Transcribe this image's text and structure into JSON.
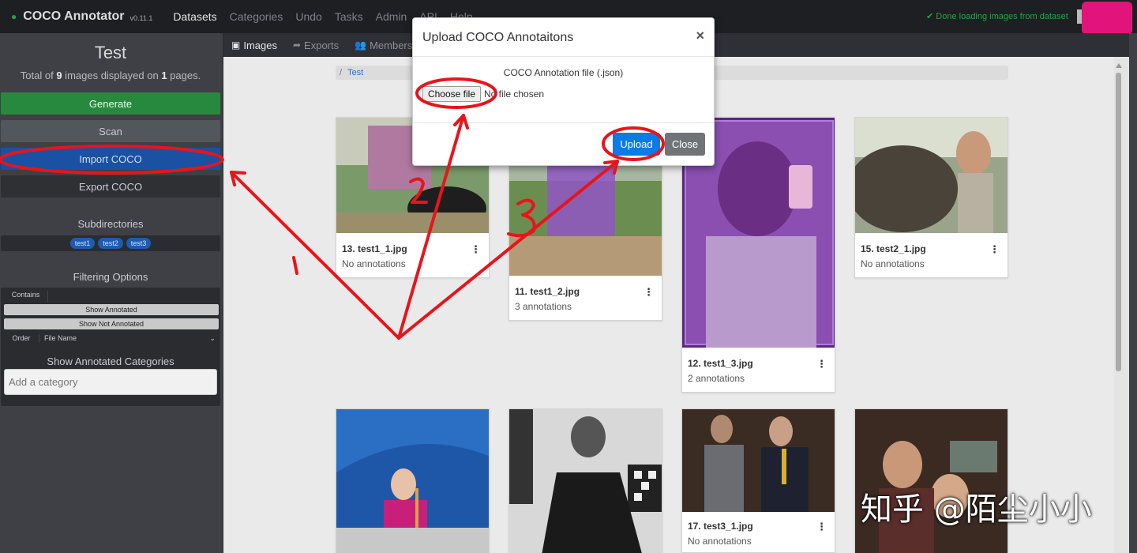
{
  "navbar": {
    "brand": "COCO Annotator",
    "version": "v0.11.1",
    "links": [
      "Datasets",
      "Categories",
      "Undo",
      "Tasks",
      "Admin",
      "API",
      "Help"
    ],
    "status": "Done loading images from dataset"
  },
  "sidebar": {
    "title": "Test",
    "info_prefix": "Total of ",
    "image_count": "9",
    "info_mid": " images displayed on ",
    "page_count": "1",
    "info_suffix": " pages.",
    "buttons": {
      "generate": "Generate",
      "scan": "Scan",
      "import": "Import COCO",
      "export": "Export COCO"
    },
    "subdirectories_label": "Subdirectories",
    "subdirectories": [
      "test1",
      "test2",
      "test3"
    ],
    "filtering_label": "Filtering Options",
    "contains_label": "Contains",
    "show_annotated": "Show Annotated",
    "show_not_annotated": "Show Not Annotated",
    "order_label": "Order",
    "order_value": "File Name",
    "categories_label": "Show Annotated Categories",
    "category_placeholder": "Add a category"
  },
  "subnav": {
    "tabs": [
      "Images",
      "Exports",
      "Members"
    ]
  },
  "breadcrumb": {
    "sep": "/",
    "current": "Test"
  },
  "cards": [
    {
      "name": "13. test1_1.jpg",
      "annotations": "No annotations"
    },
    {
      "name": "11. test1_2.jpg",
      "annotations": "3 annotations"
    },
    {
      "name": "12. test1_3.jpg",
      "annotations": "2 annotations"
    },
    {
      "name": "15. test2_1.jpg",
      "annotations": "No annotations"
    },
    {
      "name": "",
      "annotations": ""
    },
    {
      "name": "",
      "annotations": ""
    },
    {
      "name": "17. test3_1.jpg",
      "annotations": "No annotations"
    },
    {
      "name": "",
      "annotations": ""
    }
  ],
  "modal": {
    "title": "Upload COCO Annotaitons",
    "close_icon": "×",
    "file_label": "COCO Annotation file (.json)",
    "choose_file": "Choose file",
    "file_status": "No file chosen",
    "upload": "Upload",
    "close": "Close"
  },
  "watermark": "知乎 @陌尘小小",
  "colors": {
    "accent": "#0d7be6",
    "import": "#1a51a3",
    "generate": "#27893d",
    "annotation_red": "#e8141c"
  }
}
